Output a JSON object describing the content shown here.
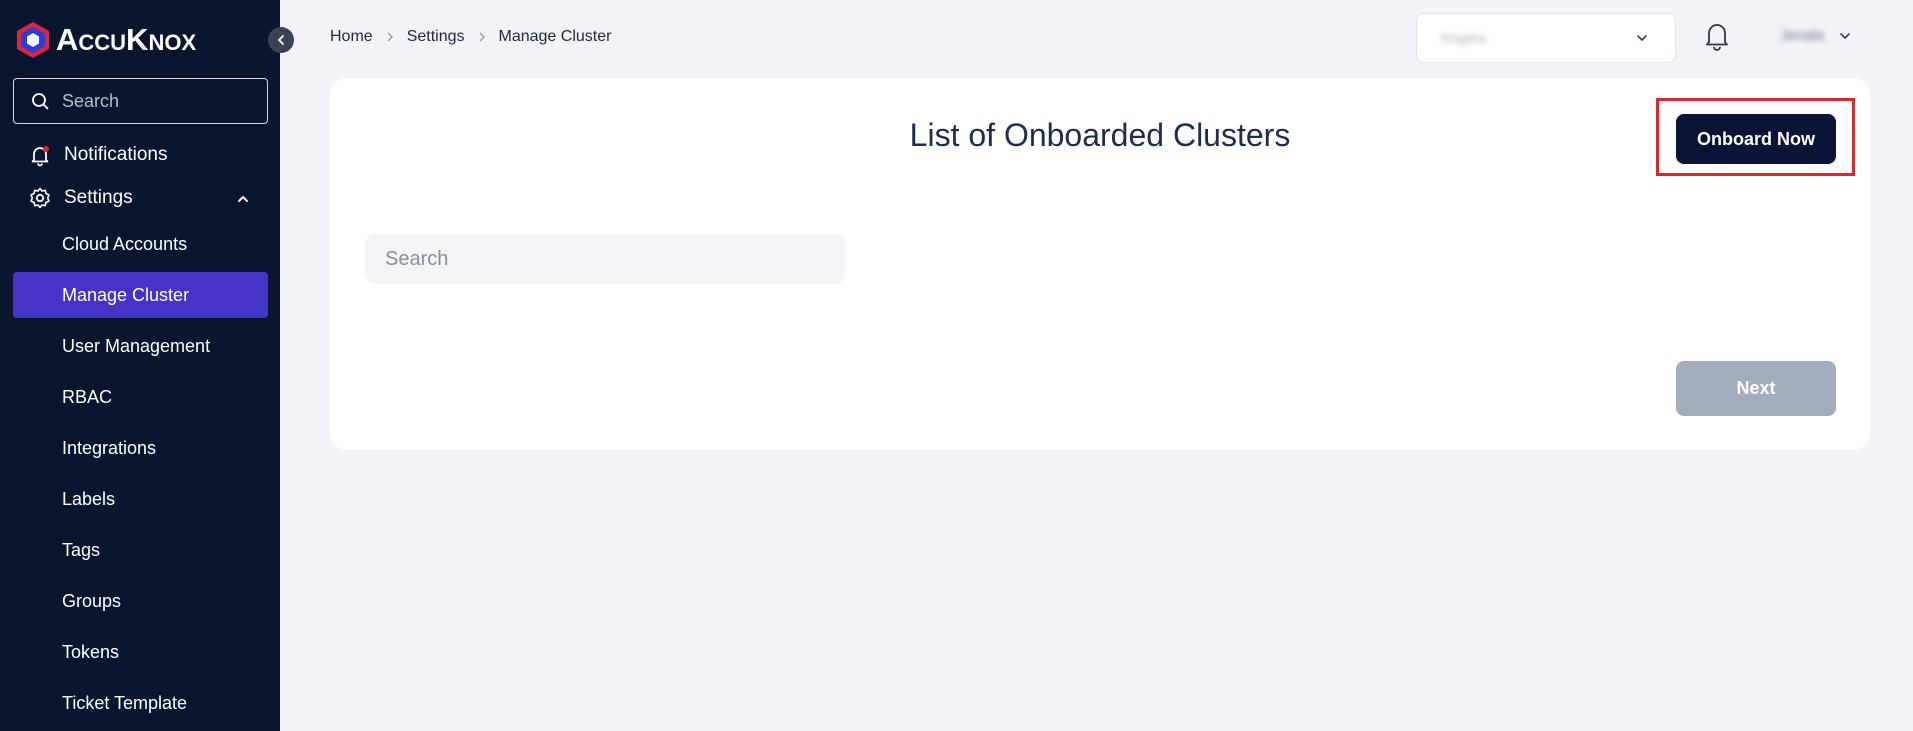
{
  "brand": {
    "name": "AccuKnox"
  },
  "sidebar": {
    "search_placeholder": "Search",
    "notifications_label": "Notifications",
    "settings_label": "Settings",
    "sub_items": [
      {
        "label": "Cloud Accounts"
      },
      {
        "label": "Manage Cluster",
        "active": true
      },
      {
        "label": "User Management"
      },
      {
        "label": "RBAC"
      },
      {
        "label": "Integrations"
      },
      {
        "label": "Labels"
      },
      {
        "label": "Tags"
      },
      {
        "label": "Groups"
      },
      {
        "label": "Tokens"
      },
      {
        "label": "Ticket Template"
      }
    ]
  },
  "breadcrumb": [
    "Home",
    "Settings",
    "Manage Cluster"
  ],
  "header": {
    "tenant_value": "Inspira",
    "user_name": "Jenala"
  },
  "main": {
    "title": "List of Onboarded Clusters",
    "onboard_label": "Onboard Now",
    "search_placeholder": "Search",
    "next_label": "Next"
  },
  "colors": {
    "sidebar_bg": "#0a1530",
    "active_item": "#4634c8",
    "primary_button": "#0b1437",
    "disabled_button": "#a3adbe",
    "highlight": "#e0262c"
  }
}
